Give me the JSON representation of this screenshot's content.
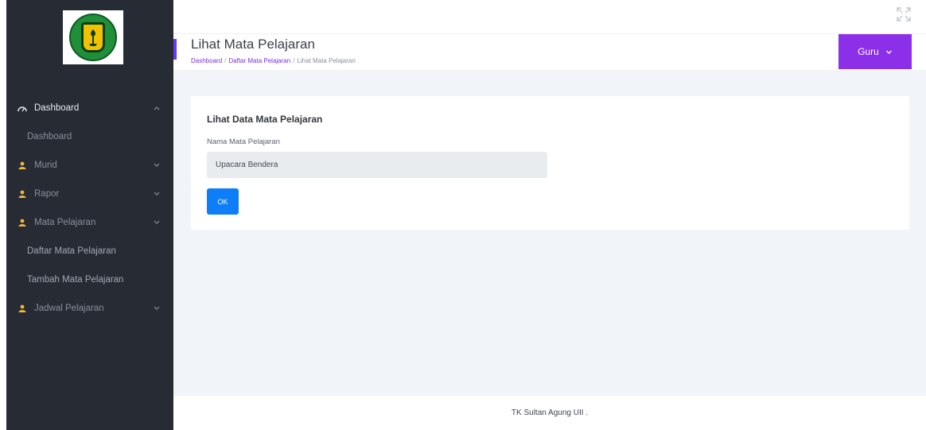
{
  "sidebar": {
    "logo_alt": "TK Sultan Agung UII logo",
    "items": [
      {
        "label": "Dashboard",
        "icon": "dashboard-icon",
        "expanded": true
      },
      {
        "label": "Dashboard"
      },
      {
        "label": "Murid",
        "icon": "user-icon"
      },
      {
        "label": "Rapor",
        "icon": "user-icon"
      },
      {
        "label": "Mata Pelajaran",
        "icon": "user-icon"
      },
      {
        "label": "Daftar Mata Pelajaran"
      },
      {
        "label": "Tambah Mata Pelajaran"
      },
      {
        "label": "Jadwal Pelajaran",
        "icon": "user-icon"
      }
    ]
  },
  "header": {
    "title": "Lihat Mata Pelajaran",
    "breadcrumb": {
      "home": "Dashboard",
      "sep1": "/",
      "parent": "Daftar Mata Pelajaran",
      "sep2": "/",
      "current": "Lihat Mata Pelajaran"
    },
    "user_menu_label": "Guru"
  },
  "card": {
    "title": "Lihat Data Mata Pelajaran",
    "field_label": "Nama Mata Pelajaran",
    "field_value": "Upacara Bendera",
    "ok_label": "OK"
  },
  "footer": {
    "text": "TK Sultan Agung UII ."
  },
  "colors": {
    "sidebar_bg": "#272b34",
    "accent_purple": "#8b2fe8",
    "breadcrumb_link": "#7a2fe0",
    "button_blue": "#0d7ef7",
    "content_bg": "#f1f4f8"
  }
}
